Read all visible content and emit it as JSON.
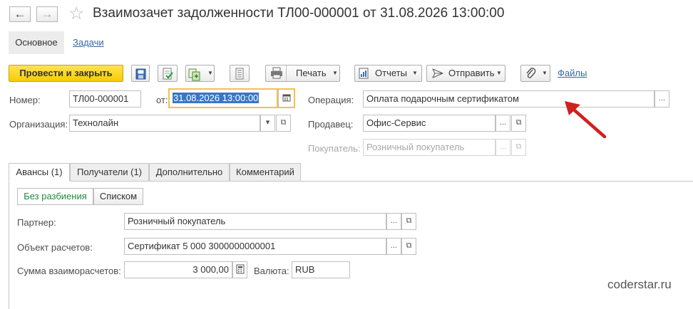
{
  "window": {
    "title": "Взаимозачет задолженности ТЛ00-000001 от 31.08.2026 13:00:00"
  },
  "topnav": {
    "main_label": "Основное",
    "tasks_label": "Задачи"
  },
  "toolbar": {
    "post_close_label": "Провести и закрыть",
    "print_label": "Печать",
    "reports_label": "Отчеты",
    "send_label": "Отправить",
    "files_label": "Файлы"
  },
  "form": {
    "number_label": "Номер:",
    "number_value": "ТЛ00-000001",
    "date_label": "от:",
    "date_value": "31.08.2026 13:00:00",
    "operation_label": "Операция:",
    "operation_value": "Оплата подарочным сертификатом",
    "org_label": "Организация:",
    "org_value": "Технолайн",
    "seller_label": "Продавец:",
    "seller_value": "Офис-Сервис",
    "buyer_label": "Покупатель:",
    "buyer_value": "Розничный покупатель"
  },
  "tabs": [
    {
      "label": "Авансы (1)"
    },
    {
      "label": "Получатели (1)"
    },
    {
      "label": "Дополнительно"
    },
    {
      "label": "Комментарий"
    }
  ],
  "advances": {
    "mode_no_split": "Без разбиения",
    "mode_list": "Списком",
    "partner_label": "Партнер:",
    "partner_value": "Розничный покупатель",
    "settlement_object_label": "Объект расчетов:",
    "settlement_object_value": "Сертификат 5 000 3000000000001",
    "amount_label": "Сумма взаиморасчетов:",
    "amount_value": "3 000,00",
    "currency_label": "Валюта:",
    "currency_value": "RUB"
  },
  "watermark": "coderstar.ru",
  "colors": {
    "primary_button": "#f7cd00",
    "link": "#3668a4",
    "selection": "#3876c5",
    "date_focus_border": "#f0c24a",
    "arrow": "#d0201f",
    "active_segment_text": "#1f8a3c"
  }
}
